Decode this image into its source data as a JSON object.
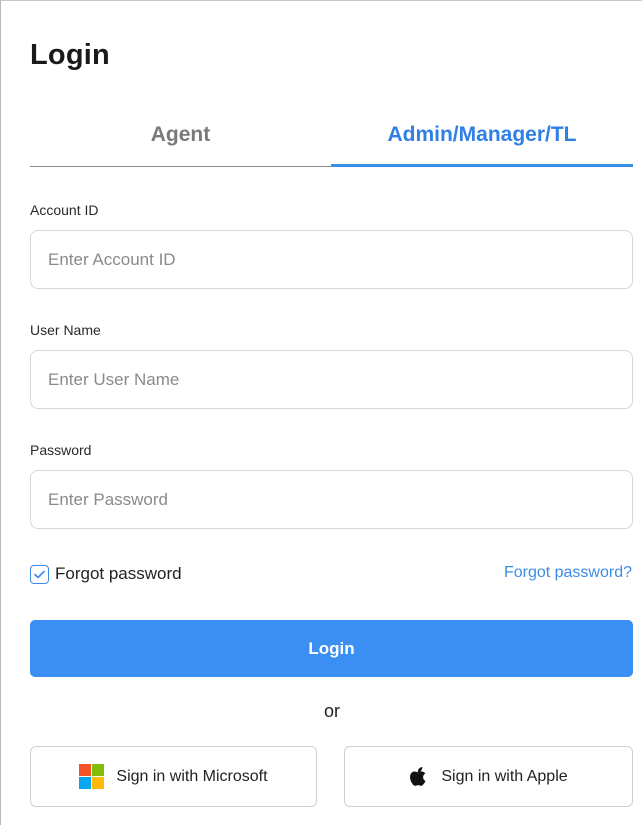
{
  "page": {
    "title": "Login"
  },
  "tabs": [
    {
      "label": "Agent",
      "active": false
    },
    {
      "label": "Admin/Manager/TL",
      "active": true
    }
  ],
  "fields": {
    "account_id": {
      "label": "Account ID",
      "placeholder": "Enter Account ID",
      "value": ""
    },
    "username": {
      "label": "User Name",
      "placeholder": "Enter User Name",
      "value": ""
    },
    "password": {
      "label": "Password",
      "placeholder": "Enter Password",
      "value": ""
    }
  },
  "remember": {
    "label": "Forgot password",
    "checked": true
  },
  "forgot_link": "Forgot password?",
  "login_button": "Login",
  "divider": "or",
  "sso": {
    "microsoft": "Sign in with Microsoft",
    "apple": "Sign in with Apple"
  },
  "colors": {
    "accent": "#3b8ce8",
    "login_button": "#3b8ef2",
    "ms_red": "#f35325",
    "ms_green": "#81bc06",
    "ms_blue": "#05a6f0",
    "ms_yellow": "#ffba08"
  },
  "icons": {
    "checkbox": "check-icon",
    "microsoft": "microsoft-logo-icon",
    "apple": "apple-logo-icon"
  }
}
